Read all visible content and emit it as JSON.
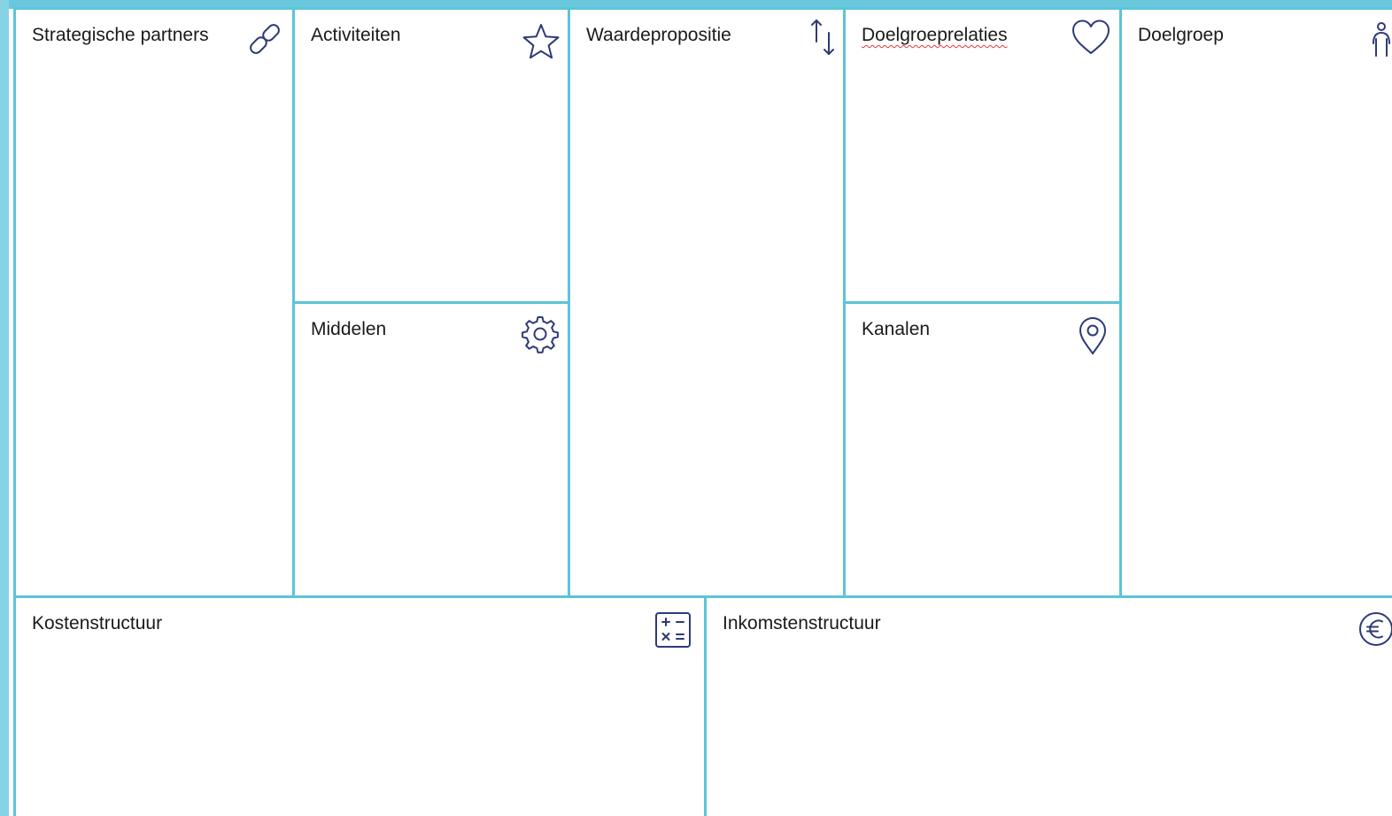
{
  "canvas": {
    "colors": {
      "frame": "#5cc4d9",
      "icon": "#2e3a78",
      "text": "#1a1a1a",
      "spellcheck": "#e53935"
    },
    "blocks": {
      "strategic_partners": {
        "title": "Strategische partners",
        "icon": "link-icon"
      },
      "activities": {
        "title": "Activiteiten",
        "icon": "star-icon"
      },
      "resources": {
        "title": "Middelen",
        "icon": "gear-icon"
      },
      "value_proposition": {
        "title": "Waardepropositie",
        "icon": "swap-arrows-icon"
      },
      "customer_relationships": {
        "title": "Doelgroeprelaties",
        "icon": "heart-icon"
      },
      "channels": {
        "title": "Kanalen",
        "icon": "map-pin-icon"
      },
      "customer_segments": {
        "title": "Doelgroep",
        "icon": "person-icon"
      },
      "cost_structure": {
        "title": "Kostenstructuur",
        "icon": "calculator-icon"
      },
      "revenue_streams": {
        "title": "Inkomstenstructuur",
        "icon": "euro-icon"
      }
    }
  }
}
